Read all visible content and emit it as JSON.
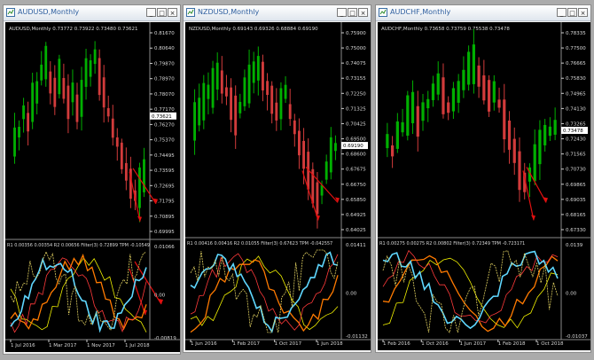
{
  "colors": {
    "bull": "#00b000",
    "bear": "#d23b3b",
    "axis": "#cfcfcf",
    "text": "#d8d8d8",
    "grid": "#6c6c6c",
    "arrow": "#e01010",
    "price_box_bg": "#ffffff"
  },
  "window_buttons": {
    "minimize": "_",
    "maximize": "□",
    "close": "×"
  },
  "windows": [
    {
      "title": "AUDUSD,Monthly",
      "ohlc_label": "AUDUSD,Monthly  0.73772 0.73922 0.73480 0.73621",
      "price_axis": [
        "0.81670",
        "0.80640",
        "0.79870",
        "0.78970",
        "0.78070",
        "0.77170",
        "0.76270",
        "0.75370",
        "0.74495",
        "0.73595",
        "0.72695",
        "0.71795",
        "0.70895",
        "0.69995"
      ],
      "current_price": "0.73621",
      "indicator_label": "R1 0.00356 0.00354  R2 0.00656  Filter(3) 0.72899  TPM -0.10549",
      "indicator_axis": [
        "0.01066",
        "0.00",
        "-0.00819"
      ],
      "time_axis": [
        "1 Jul 2016",
        "1 Mar 2017",
        "1 Nov 2017",
        "1 Jul 2018"
      ]
    },
    {
      "title": "NZDUSD,Monthly",
      "ohlc_label": "NZDUSD,Monthly  0.69143 0.69326 0.68884 0.69190",
      "price_axis": [
        "0.75900",
        "0.75000",
        "0.74075",
        "0.73155",
        "0.72250",
        "0.71325",
        "0.70425",
        "0.69500",
        "0.68600",
        "0.67675",
        "0.66750",
        "0.65850",
        "0.64925",
        "0.64025"
      ],
      "current_price": "0.69190",
      "indicator_label": "R1 0.00416 0.00416  R2 0.01055  Filter(3) 0.67623  TPM -0.042557",
      "indicator_axis": [
        "0.01411",
        "0.00",
        "-0.01132"
      ],
      "time_axis": [
        "1 Jun 2016",
        "1 Feb 2017",
        "1 Oct 2017",
        "1 Jun 2018"
      ]
    },
    {
      "title": "AUDCHF,Monthly",
      "ohlc_label": "AUDCHF,Monthly  0.73658 0.73759 0.75538 0.73478",
      "price_axis": [
        "0.78335",
        "0.77500",
        "0.76665",
        "0.75830",
        "0.74965",
        "0.74130",
        "0.73265",
        "0.72430",
        "0.71565",
        "0.70730",
        "0.69865",
        "0.69035",
        "0.68165",
        "0.67330"
      ],
      "current_price": "0.73478",
      "indicator_label": "R1 0.00275 0.00275  R2 0.00802  Filter(3) 0.72349  TPM -0.723171",
      "indicator_axis": [
        "0.0139",
        "0.00",
        "-0.01037"
      ],
      "time_axis": [
        "1 Feb 2016",
        "1 Oct 2016",
        "1 Jun 2017",
        "1 Feb 2018",
        "1 Oct 2018"
      ]
    }
  ]
}
